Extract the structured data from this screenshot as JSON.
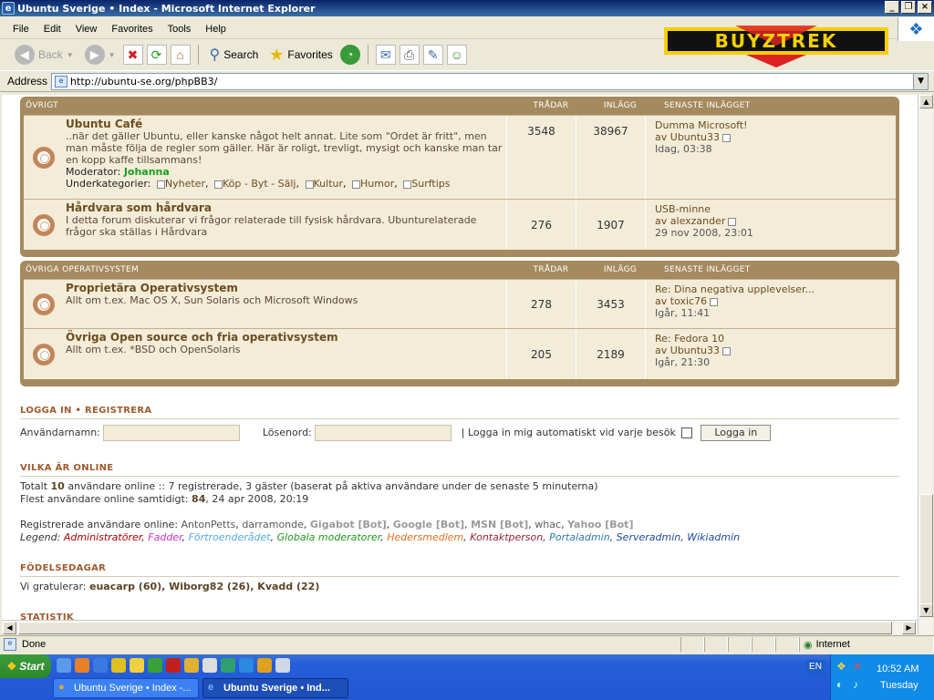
{
  "window": {
    "title": "Ubuntu Sverige • Index - Microsoft Internet Explorer"
  },
  "menu": [
    "File",
    "Edit",
    "View",
    "Favorites",
    "Tools",
    "Help"
  ],
  "toolbar": {
    "back": "Back",
    "search": "Search",
    "favorites": "Favorites"
  },
  "logo_text": "BUYZTREK",
  "address": {
    "label": "Address",
    "url": "http://ubuntu-se.org/phpBB3/"
  },
  "forum": {
    "sections": [
      {
        "title": "ÖVRIGT",
        "col_topics": "TRÅDAR",
        "col_posts": "INLÄGG",
        "col_last": "SENASTE INLÄGGET",
        "forums": [
          {
            "title": "Ubuntu Café",
            "desc": "..när det gäller Ubuntu, eller kanske något helt annat. Lite som \"Ordet är fritt\", men man måste följa de regler som gäller. Här är roligt, trevligt, mysigt och kanske man tar en kopp kaffe tillsammans!",
            "moderator_label": "Moderator:",
            "moderator": "Johanna",
            "subs_label": "Underkategorier:",
            "subs": [
              "Nyheter",
              "Köp - Byt - Sälj",
              "Kultur",
              "Humor",
              "Surftips"
            ],
            "topics": "3548",
            "posts": "38967",
            "last_title": "Dumma Microsoft!",
            "last_by_prefix": "av",
            "last_by": "Ubuntu33",
            "last_when": "Idag, 03:38"
          },
          {
            "title": "Hårdvara som hårdvara",
            "desc": "I detta forum diskuterar vi frågor relaterade till fysisk hårdvara. Ubunturelaterade frågor ska ställas i Hårdvara",
            "topics": "276",
            "posts": "1907",
            "last_title": "USB-minne",
            "last_by_prefix": "av",
            "last_by": "alexzander",
            "last_when": "29 nov 2008, 23:01"
          }
        ]
      },
      {
        "title": "ÖVRIGA OPERATIVSYSTEM",
        "col_topics": "TRÅDAR",
        "col_posts": "INLÄGG",
        "col_last": "SENASTE INLÄGGET",
        "forums": [
          {
            "title": "Proprietära Operativsystem",
            "desc": "Allt om t.ex. Mac OS X, Sun Solaris och Microsoft Windows",
            "topics": "278",
            "posts": "3453",
            "last_title": "Re: Dina negativa upplevelser...",
            "last_by_prefix": "av",
            "last_by": "toxic76",
            "last_when": "Igår, 11:41"
          },
          {
            "title": "Övriga Open source och fria operativsystem",
            "desc": "Allt om t.ex. *BSD och OpenSolaris",
            "topics": "205",
            "posts": "2189",
            "last_title": "Re: Fedora 10",
            "last_by_prefix": "av",
            "last_by": "Ubuntu33",
            "last_when": "Igår, 21:30"
          }
        ]
      }
    ]
  },
  "login": {
    "heading_login": "LOGGA IN",
    "heading_sep": "•",
    "heading_register": "REGISTRERA",
    "username_label": "Användarnamn:",
    "username_value": "",
    "password_label": "Lösenord:",
    "password_value": "",
    "auto_label": "| Logga in mig automatiskt vid varje besök",
    "button": "Logga in"
  },
  "online": {
    "heading": "VILKA ÄR ONLINE",
    "line1_pre": "Totalt",
    "line1_num": "10",
    "line1_post": "användare online :: 7 registrerade, 3 gäster (baserat på aktiva användare under de senaste 5 minuterna)",
    "line2_pre": "Flest användare online samtidigt:",
    "line2_num": "84",
    "line2_post": ", 24 apr 2008, 20:19",
    "reg_label": "Registrerade användare online:",
    "reg_users": [
      {
        "name": "AntonPetts",
        "sep": ", ",
        "color": "#5a5a5a",
        "bold": false
      },
      {
        "name": "darramonde",
        "sep": ", ",
        "color": "#5a5a5a",
        "bold": false
      },
      {
        "name": "Gigabot [Bot]",
        "sep": ", ",
        "color": "#9a9a9a",
        "bold": true
      },
      {
        "name": "Google [Bot]",
        "sep": ", ",
        "color": "#9a9a9a",
        "bold": true
      },
      {
        "name": "MSN [Bot]",
        "sep": ", ",
        "color": "#9a9a9a",
        "bold": true
      },
      {
        "name": "whac",
        "sep": ", ",
        "color": "#5a5a5a",
        "bold": false
      },
      {
        "name": "Yahoo [Bot]",
        "sep": "",
        "color": "#9a9a9a",
        "bold": true
      }
    ],
    "legend_label": "Legend:",
    "legend": [
      {
        "name": "Administratörer",
        "color": "#aa0000"
      },
      {
        "name": "Fadder",
        "color": "#cc33cc"
      },
      {
        "name": "Förtroenderådet",
        "color": "#55a8e8"
      },
      {
        "name": "Globala moderatorer",
        "color": "#1a9a1a"
      },
      {
        "name": "Hedersmedlem",
        "color": "#e07020"
      },
      {
        "name": "Kontaktperson",
        "color": "#992233"
      },
      {
        "name": "Portaladmin",
        "color": "#2e7ba8"
      },
      {
        "name": "Serveradmin",
        "color": "#1c4aa0"
      },
      {
        "name": "Wikiadmin",
        "color": "#1c4aa0"
      }
    ]
  },
  "birthdays": {
    "heading": "FÖDELSEDAGAR",
    "prefix": "Vi gratulerar:",
    "list": "euacarp (60), Wiborg82 (26), Kvadd (22)"
  },
  "stats": {
    "heading": "STATISTIK"
  },
  "status": {
    "text": "Done",
    "zone": "Internet"
  },
  "taskbar": {
    "start": "Start",
    "tasks": [
      "Ubuntu Sverige • Index -...",
      "Ubuntu Sverige • Ind..."
    ],
    "lang": "EN",
    "time": "10:52 AM",
    "day": "Tuesday"
  }
}
